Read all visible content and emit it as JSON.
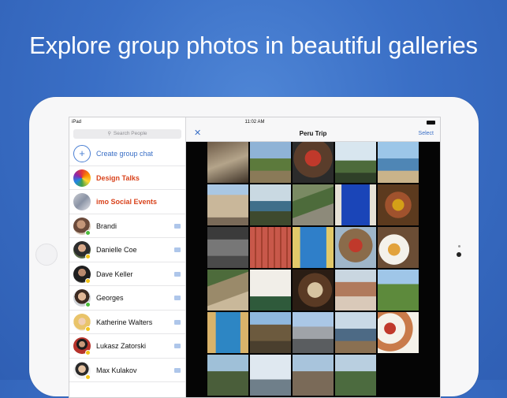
{
  "headline": "Explore group photos in beautiful galleries",
  "status_bar": {
    "device": "iPad",
    "time": "11:02 AM"
  },
  "sidebar": {
    "search_placeholder": "Search People",
    "create_label": "Create group chat",
    "groups": [
      {
        "label": "Design Talks"
      },
      {
        "label": "imo Social Events"
      }
    ],
    "contacts": [
      {
        "name": "Brandi",
        "status": "online"
      },
      {
        "name": "Danielle Coe",
        "status": "away"
      },
      {
        "name": "Dave Keller",
        "status": "away"
      },
      {
        "name": "Georges",
        "status": "online"
      },
      {
        "name": "Katherine Walters",
        "status": "away"
      },
      {
        "name": "Lukasz Zatorski",
        "status": "away"
      },
      {
        "name": "Max Kulakov",
        "status": "away"
      }
    ]
  },
  "gallery": {
    "title": "Peru Trip",
    "select_label": "Select",
    "close_label": "✕"
  },
  "colors": {
    "accent": "#3a6fc6",
    "group_text": "#d9431c",
    "online": "#4cbb3a",
    "away": "#f2c318"
  }
}
